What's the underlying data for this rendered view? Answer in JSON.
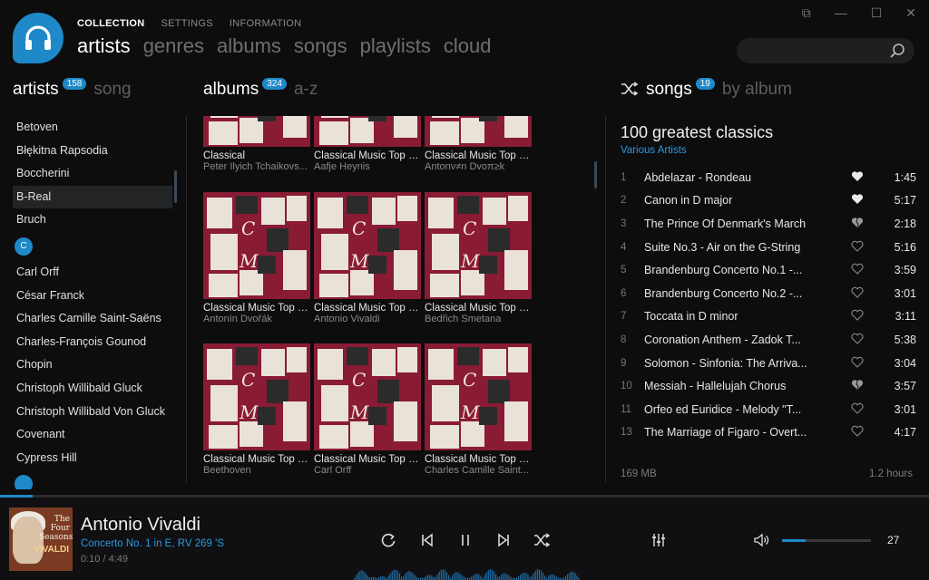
{
  "header": {
    "top_menu": [
      "COLLECTION",
      "SETTINGS",
      "INFORMATION"
    ],
    "nav_tabs": [
      "artists",
      "genres",
      "albums",
      "songs",
      "playlists",
      "cloud"
    ],
    "search_placeholder": ""
  },
  "artists_panel": {
    "title": "artists",
    "count": "158",
    "alt_tab": "song",
    "items_before": [
      "Betoven",
      "Błękitna Rapsodia",
      "Boccherini",
      "B-Real",
      "Bruch"
    ],
    "selected": "B-Real",
    "letter": "C",
    "items_after": [
      "Carl Orff",
      "César Franck",
      "Charles Camille Saint-Saëns",
      "Charles-François Gounod",
      "Chopin",
      "Christoph Willibald Gluck",
      "Christoph Willibald Von Gluck",
      "Covenant",
      "Cypress Hill"
    ]
  },
  "albums_panel": {
    "title": "albums",
    "count": "324",
    "alt_tab": "a-z",
    "albums": [
      {
        "title": "Classical",
        "artist": "Peter Ilyich Tchaikovs..."
      },
      {
        "title": "Classical Music Top 1...",
        "artist": "Aafje Heynis"
      },
      {
        "title": "Classical Music Top 1...",
        "artist": "Antonν≠n Dvoπ≥k"
      },
      {
        "title": "Classical Music Top 1...",
        "artist": "Antonín Dvořák"
      },
      {
        "title": "Classical Music Top 1...",
        "artist": "Antonio Vivaldi"
      },
      {
        "title": "Classical Music Top 1...",
        "artist": "Bedřich Smetana"
      },
      {
        "title": "Classical Music Top 1...",
        "artist": "Beethoven"
      },
      {
        "title": "Classical Music Top 1...",
        "artist": "Carl Orff"
      },
      {
        "title": "Classical Music Top 1...",
        "artist": "Charles Camille Saint..."
      }
    ]
  },
  "songs_panel": {
    "title": "songs",
    "count": "19",
    "alt_tab": "by album",
    "album_title": "100 greatest classics",
    "album_artist": "Various Artists",
    "songs": [
      {
        "n": "1",
        "title": "Abdelazar - Rondeau",
        "heart": "filled",
        "dur": "1:45"
      },
      {
        "n": "2",
        "title": "Canon in D major",
        "heart": "filled",
        "dur": "5:17"
      },
      {
        "n": "3",
        "title": "The Prince Of Denmark's March",
        "heart": "broken",
        "dur": "2:18"
      },
      {
        "n": "4",
        "title": "Suite No.3 - Air on the G-String",
        "heart": "outline",
        "dur": "5:16"
      },
      {
        "n": "5",
        "title": "Brandenburg Concerto No.1 -...",
        "heart": "outline",
        "dur": "3:59"
      },
      {
        "n": "6",
        "title": "Brandenburg Concerto No.2 -...",
        "heart": "outline",
        "dur": "3:01"
      },
      {
        "n": "7",
        "title": "Toccata in D minor",
        "heart": "outline",
        "dur": "3:11"
      },
      {
        "n": "8",
        "title": "Coronation Anthem - Zadok T...",
        "heart": "outline",
        "dur": "5:38"
      },
      {
        "n": "9",
        "title": "Solomon - Sinfonia: The Arriva...",
        "heart": "outline",
        "dur": "3:04"
      },
      {
        "n": "10",
        "title": "Messiah - Hallelujah Chorus",
        "heart": "broken",
        "dur": "3:57"
      },
      {
        "n": "11",
        "title": "Orfeo ed Euridice - Melody \"T...",
        "heart": "outline",
        "dur": "3:01"
      },
      {
        "n": "13",
        "title": "The Marriage of Figaro - Overt...",
        "heart": "outline",
        "dur": "4:17"
      }
    ],
    "size": "169 MB",
    "duration": "1.2 hours"
  },
  "player": {
    "cover_text": "The Four Seasons",
    "cover_name": "VIVALDI",
    "artist": "Antonio Vivaldi",
    "track": "Concerto No. 1 in E, RV 269 'S",
    "time": "0:10 / 4:49",
    "progress": 0.035,
    "volume": 27,
    "volume_label": "27",
    "accent": "#1f88c8"
  }
}
